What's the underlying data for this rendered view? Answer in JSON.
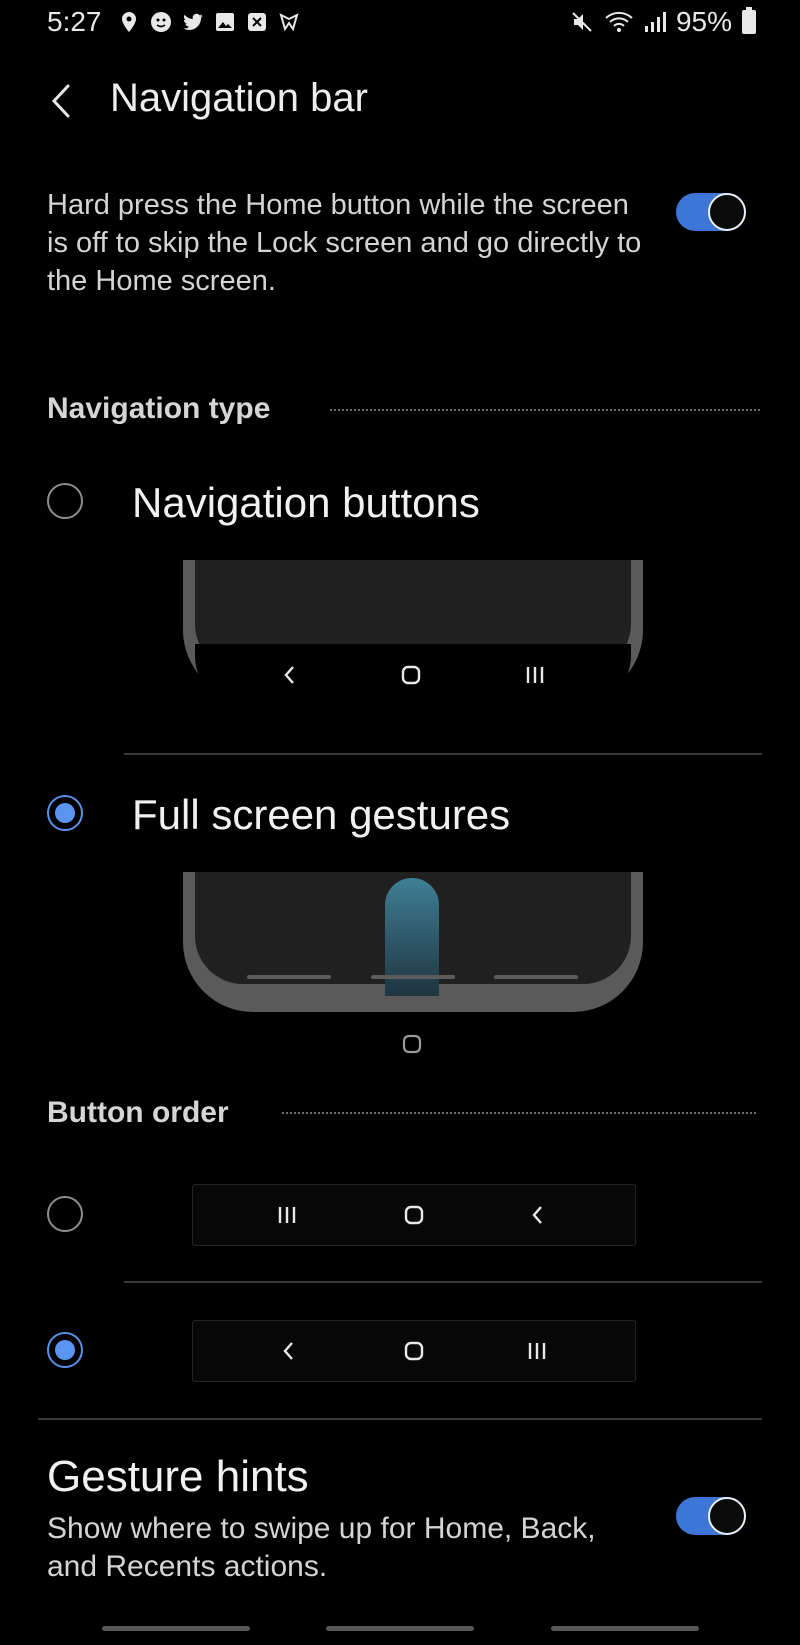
{
  "status_bar": {
    "time": "5:27",
    "battery_percent": "95%",
    "left_icons": [
      "maps-icon",
      "face-icon",
      "twitter-icon",
      "gallery-icon",
      "close-box-icon",
      "check-box-icon"
    ],
    "right_icons": [
      "mute-icon",
      "wifi-icon",
      "signal-icon",
      "battery-icon"
    ]
  },
  "header": {
    "title": "Navigation bar"
  },
  "home_button_setting": {
    "description": "Hard press the Home button while the screen is off to skip the Lock screen and go directly to the Home screen.",
    "enabled": true
  },
  "navigation_type": {
    "header": "Navigation type",
    "options": [
      {
        "label": "Navigation buttons",
        "selected": false
      },
      {
        "label": "Full screen gestures",
        "selected": true
      }
    ]
  },
  "button_order": {
    "header": "Button order",
    "options": [
      {
        "order": [
          "recents-icon",
          "home-icon",
          "back-icon"
        ],
        "selected": false
      },
      {
        "order": [
          "back-icon",
          "home-icon",
          "recents-icon"
        ],
        "selected": true
      }
    ]
  },
  "gesture_hints": {
    "title": "Gesture hints",
    "description": "Show where to swipe up for Home, Back, and Recents actions.",
    "enabled": true
  },
  "colors": {
    "background": "#000000",
    "accent": "#5b94f1",
    "toggle_track": "#3e76d6",
    "text_primary": "#f1f1f1",
    "text_secondary": "#d4d4d4"
  }
}
